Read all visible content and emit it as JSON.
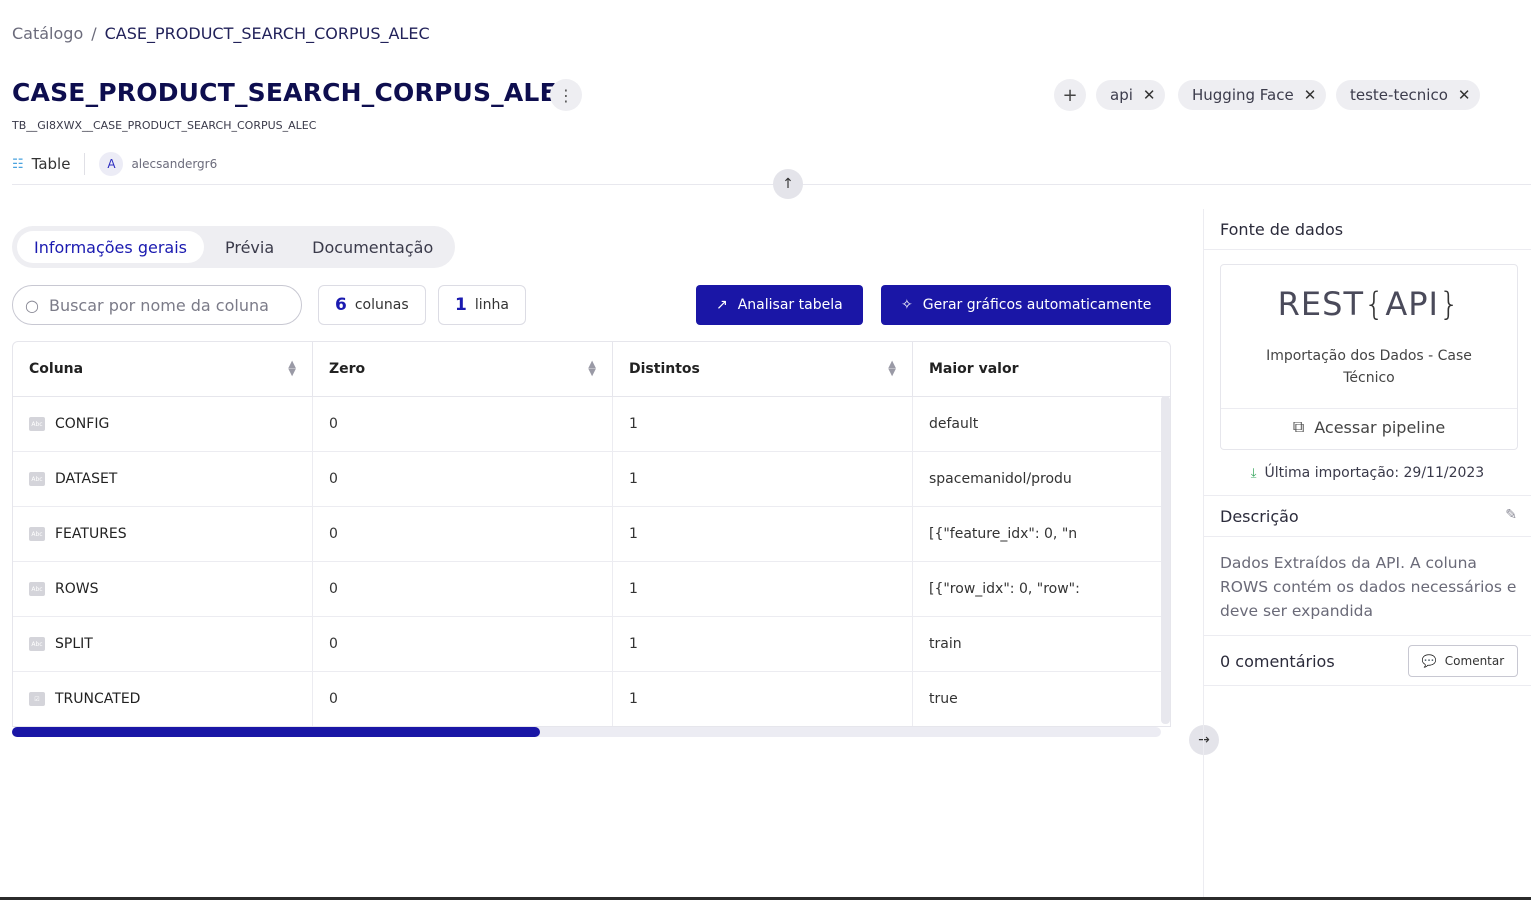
{
  "breadcrumb": {
    "root": "Catálogo",
    "separator": "/",
    "current": "CASE_PRODUCT_SEARCH_CORPUS_ALEC"
  },
  "header": {
    "title": "CASE_PRODUCT_SEARCH_CORPUS_ALEC",
    "subtitle": "TB__GI8XWX__CASE_PRODUCT_SEARCH_CORPUS_ALEC",
    "tags": [
      "api",
      "Hugging Face",
      "teste-tecnico"
    ],
    "type_label": "Table",
    "avatar_letter": "A",
    "owner": "alecsandergr6"
  },
  "tabs": [
    "Informações gerais",
    "Prévia",
    "Documentação"
  ],
  "search": {
    "placeholder": "Buscar por nome da coluna"
  },
  "stats": {
    "columns_count": "6",
    "columns_label": "colunas",
    "rows_count": "1",
    "rows_label": "linha"
  },
  "buttons": {
    "analyze": "Analisar tabela",
    "charts": "Gerar gráficos automaticamente"
  },
  "table": {
    "headers": [
      "Coluna",
      "Zero",
      "Distintos",
      "Maior valor"
    ],
    "rows": [
      {
        "type": "Abc",
        "name": "CONFIG",
        "zero": "0",
        "distinct": "1",
        "max": "default"
      },
      {
        "type": "Abc",
        "name": "DATASET",
        "zero": "0",
        "distinct": "1",
        "max": "spacemanidol/produ"
      },
      {
        "type": "Abc",
        "name": "FEATURES",
        "zero": "0",
        "distinct": "1",
        "max": "[{\"feature_idx\": 0, \"n"
      },
      {
        "type": "Abc",
        "name": "ROWS",
        "zero": "0",
        "distinct": "1",
        "max": "[{\"row_idx\": 0, \"row\":"
      },
      {
        "type": "Abc",
        "name": "SPLIT",
        "zero": "0",
        "distinct": "1",
        "max": "train"
      },
      {
        "type": "bool",
        "name": "TRUNCATED",
        "zero": "0",
        "distinct": "1",
        "max": "true"
      }
    ]
  },
  "panel": {
    "source_title": "Fonte de dados",
    "logo_rest": "REST",
    "logo_api": "API",
    "source_caption": "Importação dos Dados - Case Técnico",
    "pipeline_link": "Acessar pipeline",
    "last_import": "Última importação: 29/11/2023",
    "description_title": "Descrição",
    "description_text": "Dados Extraídos da API. A coluna ROWS contém os dados necessários e deve ser expandida",
    "comments_title": "0 comentários",
    "comment_button": "Comentar"
  },
  "colors": {
    "primary": "#1a16a6",
    "accent_text": "#1a1ab0"
  }
}
